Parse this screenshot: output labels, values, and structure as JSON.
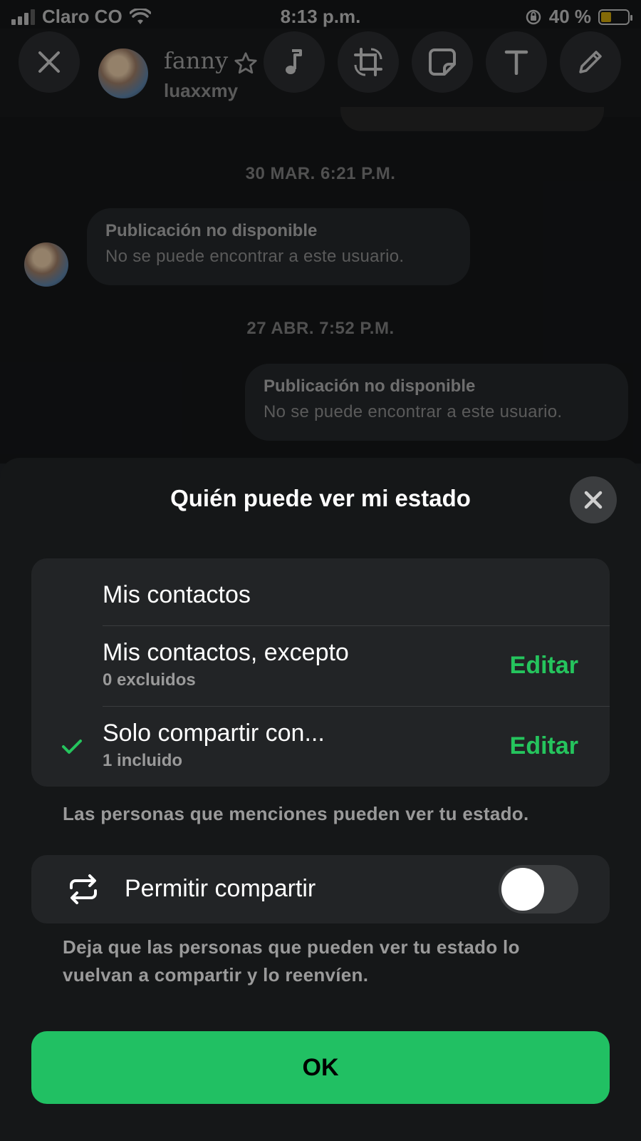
{
  "status_bar": {
    "carrier": "Claro CO",
    "time": "8:13 p.m.",
    "battery_percent": "40 %",
    "battery_level": 0.4
  },
  "editor_toolbar": {
    "icons": [
      "close-icon",
      "music-note-icon",
      "crop-rotate-icon",
      "sticker-icon",
      "text-icon",
      "pencil-icon"
    ]
  },
  "contact": {
    "name": "fanny",
    "username": "luaxxmy",
    "star_icon": "star-icon"
  },
  "chat": {
    "date_1": "30 MAR. 6:21 P.M.",
    "message_1": {
      "title": "Publicación no disponible",
      "body": "No se puede encontrar a este usuario."
    },
    "date_2": "27 ABR. 7:52 P.M.",
    "message_2": {
      "title": "Publicación no disponible",
      "body": "No se puede encontrar a este usuario."
    }
  },
  "sheet": {
    "title": "Quién puede ver mi estado",
    "options": [
      {
        "label": "Mis contactos",
        "subtitle": "",
        "action": "",
        "selected": false
      },
      {
        "label": "Mis contactos, excepto",
        "subtitle": "0 excluidos",
        "action": "Editar",
        "selected": false
      },
      {
        "label": "Solo compartir con...",
        "subtitle": "1 incluido",
        "action": "Editar",
        "selected": true
      }
    ],
    "mentions_note": "Las personas que menciones pueden ver tu estado.",
    "allow_share": {
      "label": "Permitir compartir",
      "enabled": false
    },
    "share_note_line1": "Deja que las personas que pueden ver tu estado lo",
    "share_note_line2": "vuelvan a compartir y lo reenvíen.",
    "ok_label": "OK"
  },
  "colors": {
    "accent_green": "#21c063",
    "edit_green": "#25c45d",
    "sheet_bg": "#151718",
    "card_bg": "#222426"
  }
}
